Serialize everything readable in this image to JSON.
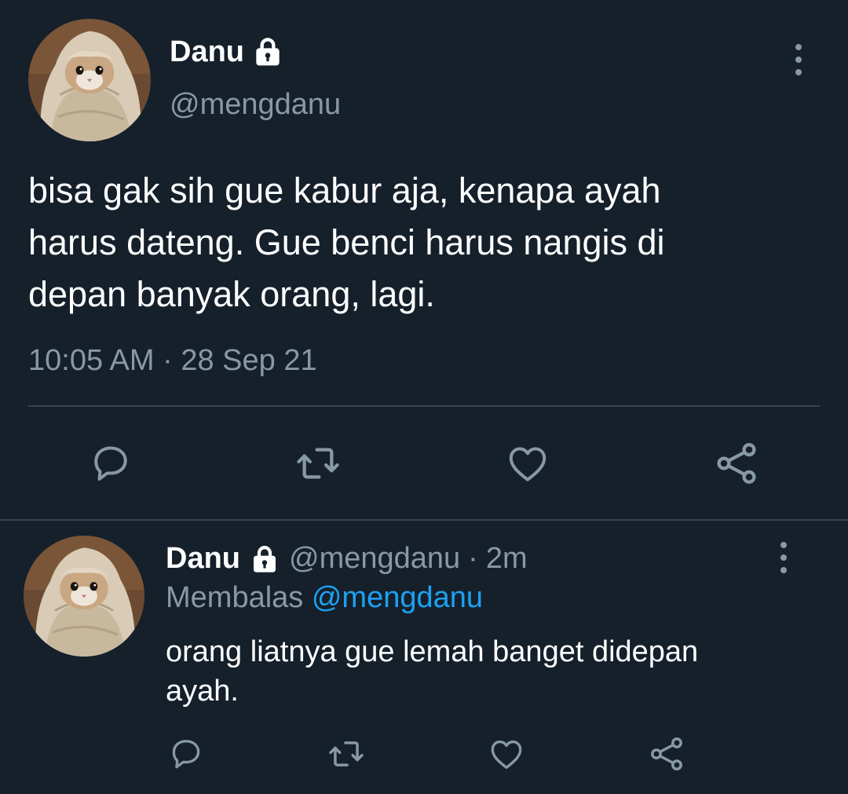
{
  "main_tweet": {
    "name": "Danu",
    "handle": "@mengdanu",
    "text": "bisa gak sih gue kabur aja, kenapa ayah\nharus dateng. Gue benci harus nangis di\ndepan banyak orang, lagi.",
    "time": "10:05 AM",
    "separator": "·",
    "date": "28 Sep 21",
    "actions": [
      "reply-icon",
      "retweet-icon",
      "like-icon",
      "share-icon"
    ]
  },
  "reply_tweet": {
    "name": "Danu",
    "handle": "@mengdanu",
    "separator": "·",
    "age": "2m",
    "replying_label": "Membalas",
    "replying_to": "@mengdanu",
    "text": "orang liatnya gue lemah banget didepan\nayah.",
    "actions": [
      "reply-icon",
      "retweet-icon",
      "like-icon",
      "share-icon"
    ]
  },
  "colors": {
    "background": "#15202b",
    "text_primary": "#ffffff",
    "text_secondary": "#8899a6",
    "accent": "#1da1f2",
    "divider": "#38444d"
  },
  "icons": {
    "protected_account": "lock-icon",
    "more_menu": "more-vertical-icon"
  }
}
